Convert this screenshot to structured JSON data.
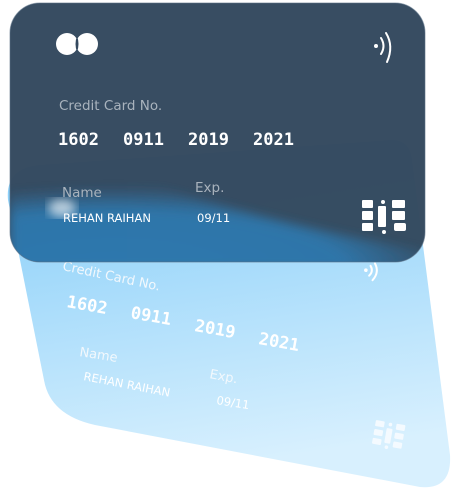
{
  "card": {
    "number_label": "Credit Card No.",
    "number_groups": [
      "1602",
      "0911",
      "2019",
      "2021"
    ],
    "name_label": "Name",
    "name": "REHAN RAIHAN",
    "exp_label": "Exp.",
    "exp": "09/11",
    "icons": {
      "brand": "brand-circles-icon",
      "contactless": "contactless-icon",
      "chip": "chip-icon"
    }
  },
  "colors": {
    "front_card": "#34495f",
    "back_card_top": "#86cff8",
    "back_card_bottom": "#d4eefd",
    "glow": "#2f7ab0"
  }
}
